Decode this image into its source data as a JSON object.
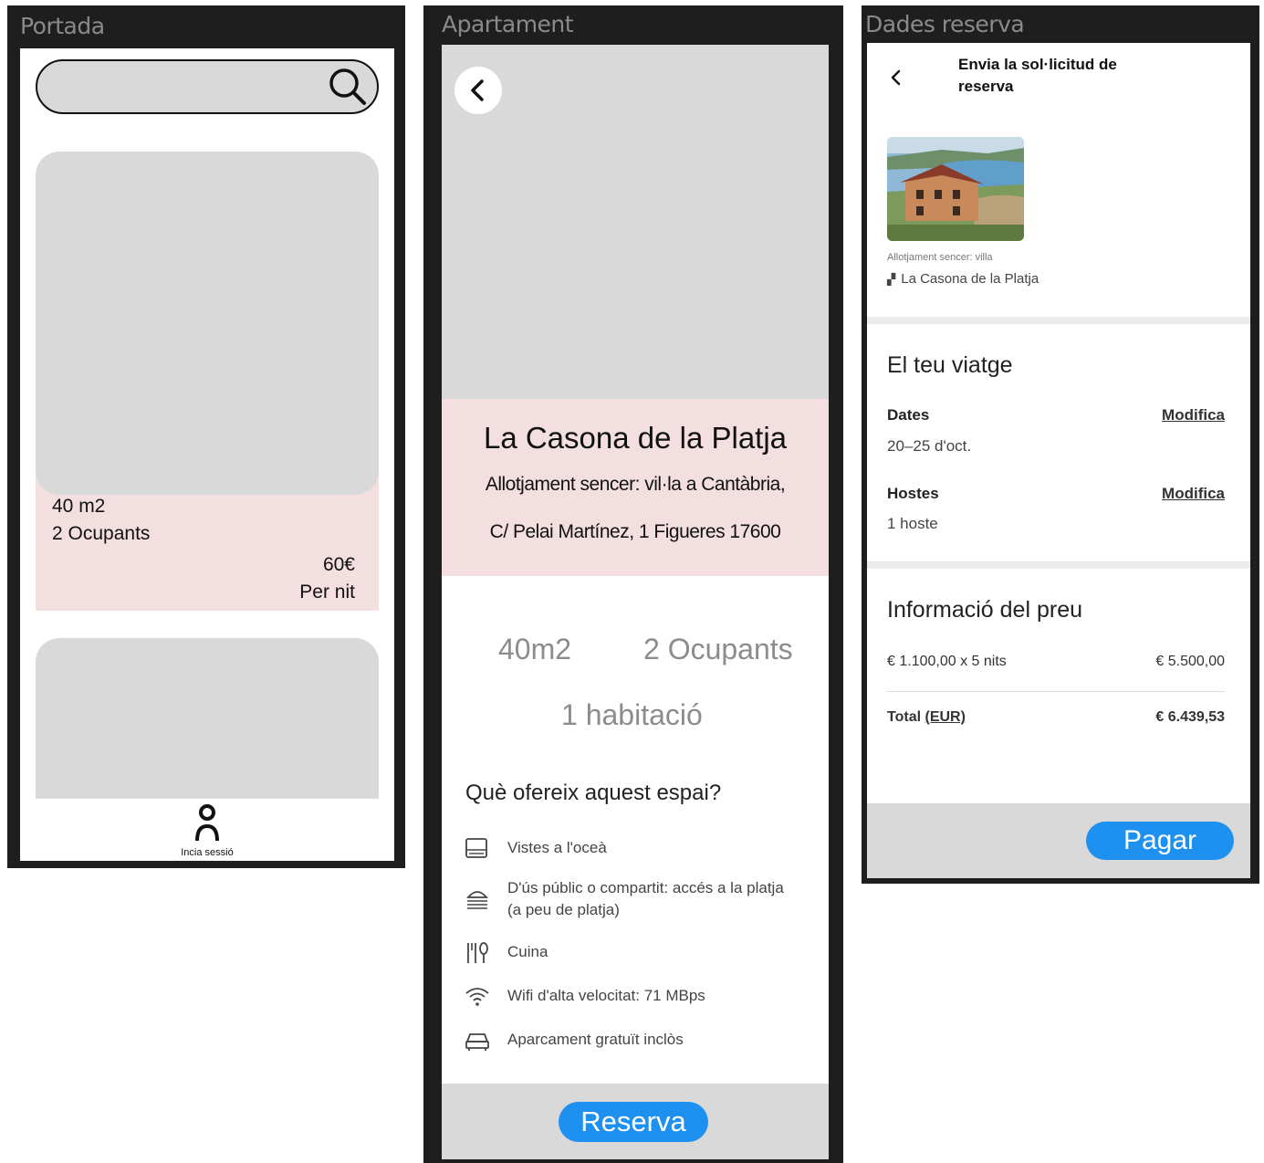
{
  "screens": {
    "portada": {
      "title": "Portada",
      "search": {
        "icon": "search-icon"
      },
      "listing": {
        "area": "40 m2",
        "occupants": "2 Ocupants",
        "price": "60€",
        "price_unit": "Per nit"
      },
      "login": {
        "label": "Incia sessió",
        "icon": "user-icon"
      }
    },
    "apartament": {
      "title": "Apartament",
      "name": "La Casona de la Platja",
      "subtitle": "Allotjament sencer: vil·la a Cantàbria,",
      "address": "C/ Pelai Martínez, 1 Figueres 17600",
      "stats": {
        "area": "40m2",
        "occupants": "2 Ocupants",
        "rooms": "1 habitació"
      },
      "offers_title": "Què ofereix aquest espai?",
      "amenities": [
        {
          "icon": "ocean-view-icon",
          "label": "Vistes a l'oceà"
        },
        {
          "icon": "beach-access-icon",
          "label": "D'ús públic o compartit: accés a la platja (a peu de platja)"
        },
        {
          "icon": "kitchen-icon",
          "label": "Cuina"
        },
        {
          "icon": "wifi-icon",
          "label": "Wifi d'alta velocitat: 71 MBps"
        },
        {
          "icon": "car-icon",
          "label": "Aparcament gratuït inclòs"
        }
      ],
      "reserve_button": "Reserva"
    },
    "dades_reserva": {
      "title": "Dades reserva",
      "header": "Envia la sol·licitud de reserva",
      "property_type": "Allotjament sencer: villa",
      "property_name": "La Casona de la Platja",
      "trip_title": "El teu viatge",
      "dates_label": "Dates",
      "dates_value": "20–25 d'oct.",
      "guests_label": "Hostes",
      "guests_value": "1 hoste",
      "modify_label": "Modifica",
      "price_title": "Informació del preu",
      "price_line_label": "€ 1.100,00 x 5 nits",
      "price_line_value": "€ 5.500,00",
      "total_label": "Total",
      "total_currency": "(EUR)",
      "total_value": "€ 6.439,53",
      "pay_button": "Pagar"
    }
  },
  "colors": {
    "frame": "#1e1e1e",
    "placeholder": "#d9d9d9",
    "pink": "#f3dfe0",
    "accent": "#1e90f0"
  }
}
